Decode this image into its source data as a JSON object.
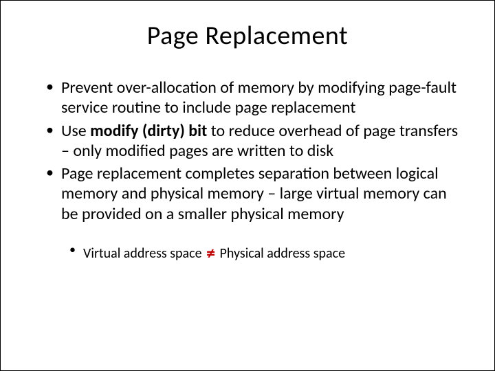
{
  "slide": {
    "title": "Page Replacement",
    "bullets": [
      {
        "pre": "Prevent over-allocation of memory by modifying page-fault service routine to include page replacement",
        "bold": "",
        "post": ""
      },
      {
        "pre": "Use ",
        "bold": "modify (dirty) bit ",
        "post": "to reduce overhead of page transfers – only modified pages are written to disk"
      },
      {
        "pre": "Page replacement completes separation between logical memory and physical memory – large virtual memory can be provided on a smaller physical memory",
        "bold": "",
        "post": ""
      }
    ],
    "sub_bullet": {
      "left": "Virtual address space ",
      "symbol": "≠",
      "right": " Physical address space"
    }
  }
}
